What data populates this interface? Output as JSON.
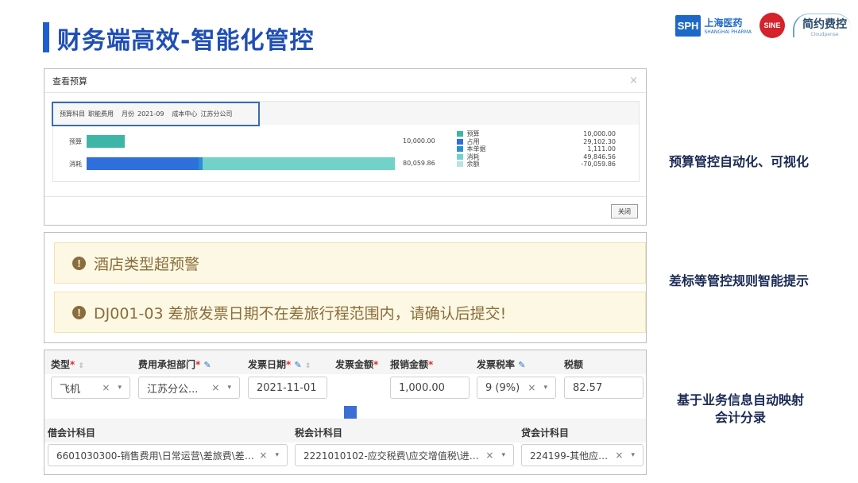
{
  "slide": {
    "title": "财务端高效-智能化管控"
  },
  "logos": {
    "sph_box": "SPH",
    "sph_cn": "上海医药",
    "sph_en": "SHANGHAI PHARMA",
    "sine": "SINE",
    "jy_cn": "简约费控",
    "jy_en": "Cloudpense"
  },
  "budget": {
    "dialog_title": "查看预算",
    "close_glyph": "×",
    "filter": {
      "subject_label": "预算科目",
      "subject_value": "职能费用",
      "month_label": "月份",
      "month_value": "2021-09",
      "center_label": "成本中心",
      "center_value": "江苏分公司"
    },
    "rows": [
      {
        "label": "预算",
        "value_text": "10,000.00"
      },
      {
        "label": "消耗",
        "value_text": "80,059.86"
      }
    ],
    "close_button": "关闭"
  },
  "chart_data": {
    "type": "bar",
    "categories": [
      "预算",
      "消耗"
    ],
    "series": [
      {
        "name": "预算",
        "values": [
          10000.0,
          0
        ]
      },
      {
        "name": "占用",
        "values": [
          0,
          29102.3
        ]
      },
      {
        "name": "本单据",
        "values": [
          0,
          1111.0
        ]
      },
      {
        "name": "消耗",
        "values": [
          0,
          49846.56
        ]
      }
    ],
    "totals": [
      10000.0,
      80059.86
    ],
    "legend": [
      {
        "name": "预算",
        "value": "10,000.00",
        "color": "#3db6a8"
      },
      {
        "name": "占用",
        "value": "29,102.30",
        "color": "#2f6fdc"
      },
      {
        "name": "本单据",
        "value": "1,111.00",
        "color": "#2a8fd6"
      },
      {
        "name": "消耗",
        "value": "49,846.56",
        "color": "#72d1c8"
      },
      {
        "name": "余额",
        "value": "-70,059.86",
        "color": "#b9e3e0"
      }
    ],
    "xlim": [
      0,
      80059.86
    ],
    "legend_position": "right",
    "grid": false
  },
  "warnings": [
    {
      "text": "酒店类型超预警"
    },
    {
      "text": "DJ001-03 差旅发票日期不在差旅行程范围内，请确认后提交!"
    }
  ],
  "form": {
    "headers": {
      "type": "类型",
      "dept": "费用承担部门",
      "invoice_date": "发票日期",
      "invoice_amount": "发票金额",
      "reimb_amount": "报销金额",
      "tax_rate": "发票税率",
      "tax": "税额"
    },
    "required_mark": "*",
    "values": {
      "type": "飞机",
      "dept": "江苏分公...",
      "invoice_date": "2021-11-01",
      "invoice_amount": "",
      "reimb_amount": "1,000.00",
      "tax_rate": "9 (9%)",
      "tax": "82.57"
    },
    "accounts_headers": {
      "debit": "借会计科目",
      "tax": "税会计科目",
      "credit": "贷会计科目"
    },
    "accounts_values": {
      "debit": "6601030300-销售费用\\日常运营\\差旅费\\差旅费...",
      "tax": "2221010102-应交税费\\应交增值税\\进项税...",
      "credit": "224199-其他应付款..."
    },
    "clear_glyph": "×",
    "caret_glyph": "▾"
  },
  "side_labels": {
    "a": "预算管控自动化、可视化",
    "b": "差标等管控规则智能提示",
    "c1": "基于业务信息自动映射",
    "c2": "会计分录"
  },
  "colors": {
    "title": "#1f4fb4",
    "accent_bar": "#1d5fd0",
    "warn_bg": "#fcf8e3",
    "warn_text": "#8a6d3b"
  }
}
